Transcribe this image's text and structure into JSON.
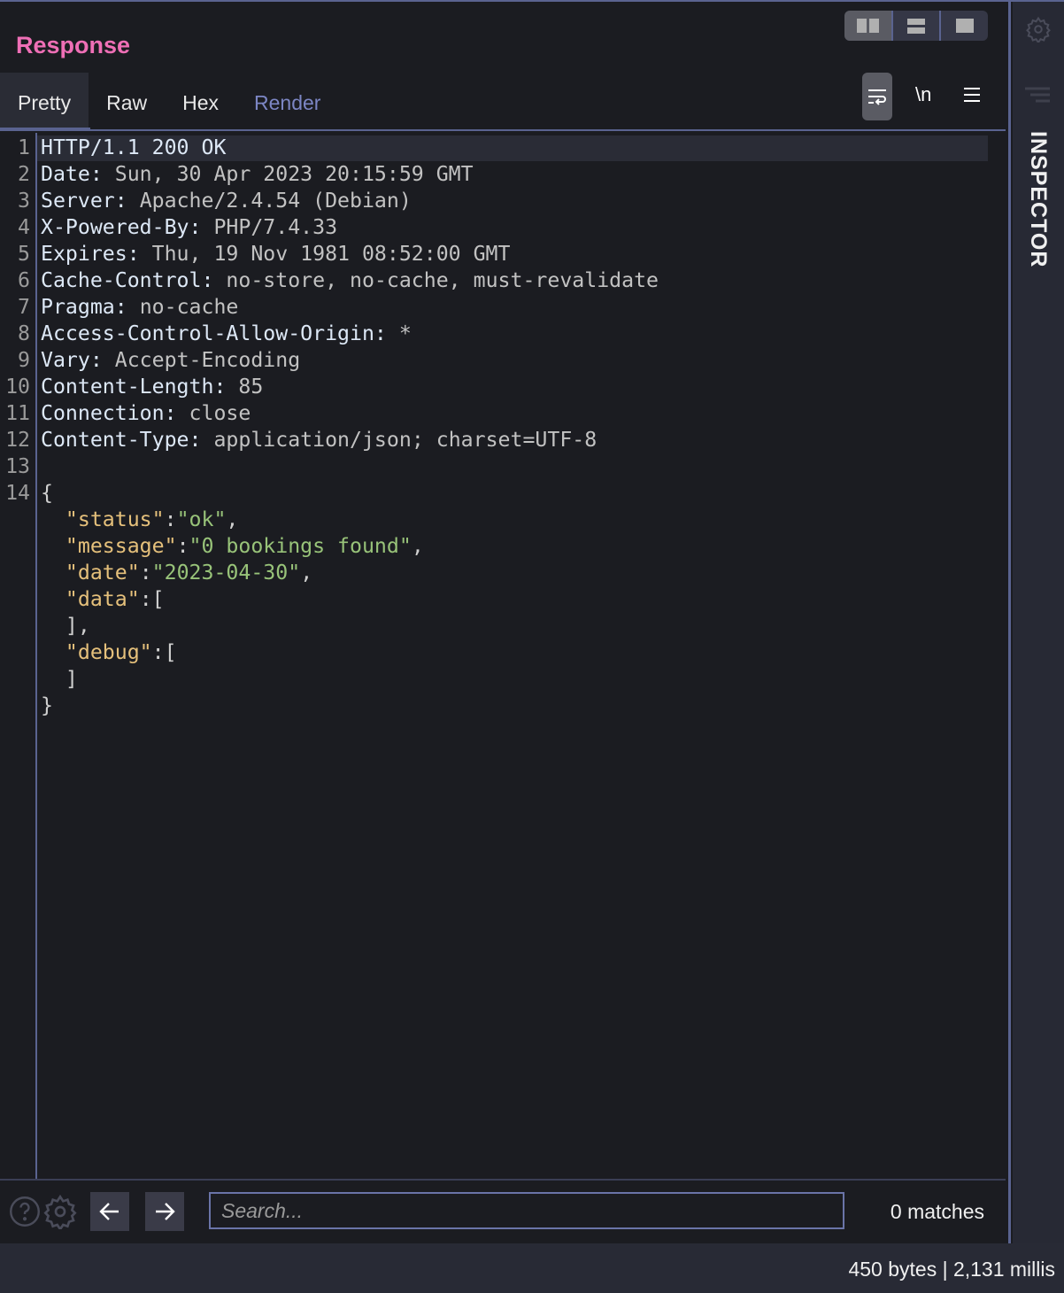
{
  "panel": {
    "title": "Response"
  },
  "tabs": [
    {
      "label": "Pretty",
      "active": true
    },
    {
      "label": "Raw"
    },
    {
      "label": "Hex"
    },
    {
      "label": "Render"
    }
  ],
  "toolbar": {
    "wrap_icon": "word-wrap-icon",
    "newline_label": "\\n",
    "menu_icon": "hamburger-icon",
    "layout_icons": [
      "split-vertical-icon",
      "split-horizontal-icon",
      "single-pane-icon"
    ]
  },
  "lines": [
    [
      {
        "t": "HTTP/1.1 200 OK",
        "c": "hn"
      }
    ],
    [
      {
        "t": "Date: ",
        "c": "hn"
      },
      {
        "t": "Sun, 30 Apr 2023 20:15:59 GMT",
        "c": "hv"
      }
    ],
    [
      {
        "t": "Server: ",
        "c": "hn"
      },
      {
        "t": "Apache/2.4.54 (Debian)",
        "c": "hv"
      }
    ],
    [
      {
        "t": "X-Powered-By: ",
        "c": "hn"
      },
      {
        "t": "PHP/7.4.33",
        "c": "hv"
      }
    ],
    [
      {
        "t": "Expires: ",
        "c": "hn"
      },
      {
        "t": "Thu, 19 Nov 1981 08:52:00 GMT",
        "c": "hv"
      }
    ],
    [
      {
        "t": "Cache-Control: ",
        "c": "hn"
      },
      {
        "t": "no-store, no-cache, must-revalidate",
        "c": "hv"
      }
    ],
    [
      {
        "t": "Pragma: ",
        "c": "hn"
      },
      {
        "t": "no-cache",
        "c": "hv"
      }
    ],
    [
      {
        "t": "Access-Control-Allow-Origin: ",
        "c": "hn"
      },
      {
        "t": "*",
        "c": "hv"
      }
    ],
    [
      {
        "t": "Vary: ",
        "c": "hn"
      },
      {
        "t": "Accept-Encoding",
        "c": "hv"
      }
    ],
    [
      {
        "t": "Content-Length: ",
        "c": "hn"
      },
      {
        "t": "85",
        "c": "hv"
      }
    ],
    [
      {
        "t": "Connection: ",
        "c": "hn"
      },
      {
        "t": "close",
        "c": "hv"
      }
    ],
    [
      {
        "t": "Content-Type: ",
        "c": "hn"
      },
      {
        "t": "application/json; charset=UTF-8",
        "c": "hv"
      }
    ],
    [],
    [
      {
        "t": "{",
        "c": "jp"
      }
    ]
  ],
  "json_lines": [
    [
      {
        "t": "  "
      },
      {
        "t": "\"status\"",
        "c": "jk"
      },
      {
        "t": ":",
        "c": "jp"
      },
      {
        "t": "\"ok\"",
        "c": "jv"
      },
      {
        "t": ",",
        "c": "jp"
      }
    ],
    [
      {
        "t": "  "
      },
      {
        "t": "\"message\"",
        "c": "jk"
      },
      {
        "t": ":",
        "c": "jp"
      },
      {
        "t": "\"0 bookings found\"",
        "c": "jv"
      },
      {
        "t": ",",
        "c": "jp"
      }
    ],
    [
      {
        "t": "  "
      },
      {
        "t": "\"date\"",
        "c": "jk"
      },
      {
        "t": ":",
        "c": "jp"
      },
      {
        "t": "\"2023-04-30\"",
        "c": "jv"
      },
      {
        "t": ",",
        "c": "jp"
      }
    ],
    [
      {
        "t": "  "
      },
      {
        "t": "\"data\"",
        "c": "jk"
      },
      {
        "t": ":[",
        "c": "jp"
      }
    ],
    [
      {
        "t": "  ],",
        "c": "jp"
      }
    ],
    [
      {
        "t": "  "
      },
      {
        "t": "\"debug\"",
        "c": "jk"
      },
      {
        "t": ":[",
        "c": "jp"
      }
    ],
    [
      {
        "t": "  ]",
        "c": "jp"
      }
    ],
    [
      {
        "t": "}",
        "c": "jp"
      }
    ]
  ],
  "search": {
    "placeholder": "Search...",
    "value": "",
    "matches": "0 matches"
  },
  "status": {
    "text": "450 bytes | 2,131 millis"
  },
  "sidebar": {
    "label": "INSPECTOR"
  }
}
